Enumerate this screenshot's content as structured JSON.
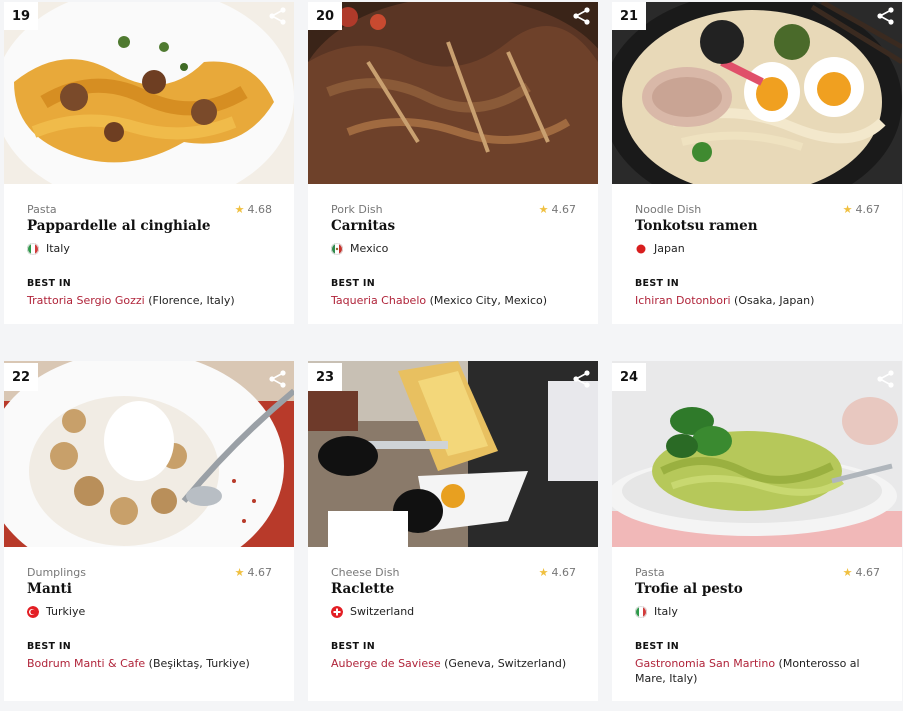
{
  "cards": [
    {
      "rank": "19",
      "category": "Pasta",
      "rating": "4.68",
      "name": "Pappardelle al cinghiale",
      "country": "Italy",
      "best_in_label": "BEST IN",
      "restaurant": "Trattoria Sergio Gozzi",
      "location": " (Florence, Italy)"
    },
    {
      "rank": "20",
      "category": "Pork Dish",
      "rating": "4.67",
      "name": "Carnitas",
      "country": "Mexico",
      "best_in_label": "BEST IN",
      "restaurant": "Taqueria Chabelo",
      "location": " (Mexico City, Mexico)"
    },
    {
      "rank": "21",
      "category": "Noodle Dish",
      "rating": "4.67",
      "name": "Tonkotsu ramen",
      "country": "Japan",
      "best_in_label": "BEST IN",
      "restaurant": "Ichiran Dotonbori",
      "location": " (Osaka, Japan)"
    },
    {
      "rank": "22",
      "category": "Dumplings",
      "rating": "4.67",
      "name": "Manti",
      "country": "Turkiye",
      "best_in_label": "BEST IN",
      "restaurant": "Bodrum Manti & Cafe",
      "location": " (Beşiktaş, Turkiye)"
    },
    {
      "rank": "23",
      "category": "Cheese Dish",
      "rating": "4.67",
      "name": "Raclette",
      "country": "Switzerland",
      "best_in_label": "BEST IN",
      "restaurant": "Auberge de Saviese",
      "location": " (Geneva, Switzerland)"
    },
    {
      "rank": "24",
      "category": "Pasta",
      "rating": "4.67",
      "name": "Trofie al pesto",
      "country": "Italy",
      "best_in_label": "BEST IN",
      "restaurant": "Gastronomia San Martino",
      "location": " (Monterosso al Mare, Italy)"
    }
  ],
  "icons": {
    "share": "share-icon",
    "star": "star-icon"
  },
  "colors": {
    "accent": "#b0243a",
    "star": "#f0c040"
  }
}
